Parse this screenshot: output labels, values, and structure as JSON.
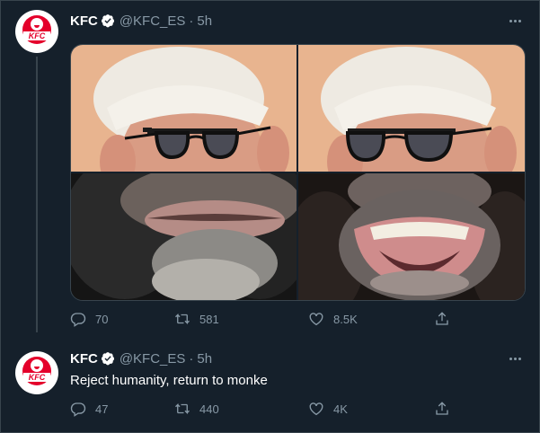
{
  "tweets": [
    {
      "name": "KFC",
      "handle": "@KFC_ES",
      "separator": "·",
      "time": "5h",
      "avatar_text": "KFC",
      "media_alt": "Colonel Sanders face collage with chimpanzee mouths",
      "actions": {
        "replies": "70",
        "retweets": "581",
        "likes": "8.5K"
      }
    },
    {
      "name": "KFC",
      "handle": "@KFC_ES",
      "separator": "·",
      "time": "5h",
      "avatar_text": "KFC",
      "text": "Reject humanity, return to monke",
      "actions": {
        "replies": "47",
        "retweets": "440",
        "likes": "4K"
      }
    }
  ],
  "colors": {
    "background": "#15202b",
    "secondary_text": "#8899a6",
    "border": "#38444d",
    "brand_red": "#e4002b",
    "verified": "#ffffff"
  },
  "icons": [
    "kfc-logo-icon",
    "verified-icon",
    "more-icon",
    "reply-icon",
    "retweet-icon",
    "like-icon",
    "share-icon"
  ]
}
